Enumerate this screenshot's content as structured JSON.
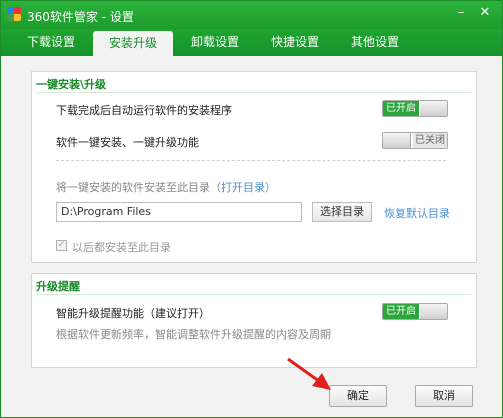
{
  "window": {
    "title": "360软件管家 - 设置"
  },
  "tabs": [
    "下载设置",
    "安装升级",
    "卸载设置",
    "快捷设置",
    "其他设置"
  ],
  "active_tab": "安装升级",
  "section1": {
    "title": "一键安装\\升级",
    "auto_run_label": "下载完成后自动运行软件的安装程序",
    "auto_run_state": "已开启",
    "one_click_label": "软件一键安装、一键升级功能",
    "one_click_state": "已关闭",
    "install_dir_label": "将一键安装的软件安装至此目录（",
    "open_dir_link": "打开目录",
    "install_dir_close": "）",
    "install_dir_value": "D:\\Program Files",
    "choose_dir_button": "选择目录",
    "restore_default_link": "恢复默认目录",
    "always_install_label": "以后都安装至此目录"
  },
  "section2": {
    "title": "升级提醒",
    "smart_label": "智能升级提醒功能（建议打开）",
    "smart_state": "已开启",
    "smart_desc": "根据软件更新频率，智能调整软件升级提醒的内容及周期"
  },
  "footer": {
    "ok": "确定",
    "cancel": "取消"
  },
  "colors": {
    "accent": "#1fa52f",
    "toggle_on": "#2aa63a",
    "link": "#4a8fd6",
    "arrow": "#e0201a"
  }
}
